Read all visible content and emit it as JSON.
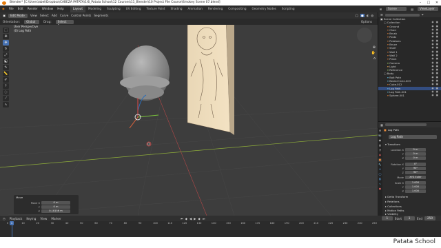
{
  "window": {
    "title": "Blender* [C:\\Users\\abel\\Dropbox\\CABEZA PATATA\\1\\6_Patata School\\12 Courses\\11_Blender\\10 Project File Course\\Smokey Scene 07.blend]",
    "controls": [
      "–",
      "□",
      "✕"
    ]
  },
  "menubar": {
    "menus": [
      "File",
      "Edit",
      "Render",
      "Window",
      "Help"
    ],
    "workspaces": [
      "Layout",
      "Modeling",
      "Sculpting",
      "UV Editing",
      "Texture Paint",
      "Shading",
      "Animation",
      "Rendering",
      "Compositing",
      "Geometry Nodes",
      "Scripting"
    ],
    "active_workspace": "Layout",
    "scene": "Scene",
    "view_layer": "ViewLayer"
  },
  "viewport": {
    "mode": "Edit Mode",
    "menus": [
      "View",
      "Select",
      "Add",
      "Curve",
      "Control Points",
      "Segments"
    ],
    "orientation_label": "Orientation:",
    "orientation_value": "Global",
    "drag_label": "Drag:",
    "drag_value": "Select Box",
    "options_label": "Options",
    "view_name": "User Perspective",
    "object_name": "(0) Log Path"
  },
  "last_operator": {
    "title": "Move",
    "rows": [
      {
        "label": "Move X",
        "value": "0 m"
      },
      {
        "label": "Y",
        "value": "0 m"
      },
      {
        "label": "Z",
        "value": "0.18156 m"
      }
    ],
    "axis_ortho_label": "Axis Ortho",
    "axis_ortho_value": "X",
    "orientation_label": "Orientation",
    "orientation_value": "Global",
    "proportional_label": "Proportional Editing"
  },
  "outliner": {
    "root": "Scene Collection",
    "items": [
      {
        "name": "Collection",
        "indent": 1,
        "color": "#d0d0d0"
      },
      {
        "name": "Ground",
        "indent": 2,
        "color": "#d07a3a"
      },
      {
        "name": "Chair",
        "indent": 2,
        "color": "#d07a3a"
      },
      {
        "name": "Brush",
        "indent": 2,
        "color": "#d07a3a"
      },
      {
        "name": "Posts",
        "indent": 2,
        "color": "#d07a3a"
      },
      {
        "name": "Potatoes",
        "indent": 2,
        "color": "#d07a3a"
      },
      {
        "name": "Bruce",
        "indent": 2,
        "color": "#d07a3a"
      },
      {
        "name": "Shelf",
        "indent": 2,
        "color": "#d07a3a"
      },
      {
        "name": "Wall 1",
        "indent": 2,
        "color": "#d07a3a"
      },
      {
        "name": "Wall 2",
        "indent": 2,
        "color": "#d07a3a"
      },
      {
        "name": "Plank",
        "indent": 2,
        "color": "#d07a3a"
      },
      {
        "name": "Camera",
        "indent": 2,
        "color": "#9acd60"
      },
      {
        "name": "Light",
        "indent": 2,
        "color": "#e0a050"
      },
      {
        "name": "Reference",
        "indent": 2,
        "color": "#9acd60"
      },
      {
        "name": "Body",
        "indent": 1,
        "color": "#d0d0d0"
      },
      {
        "name": "Bolt Path",
        "indent": 2,
        "color": "#5fb7d6"
      },
      {
        "name": "BezierCircle.003",
        "indent": 2,
        "color": "#5fb7d6"
      },
      {
        "name": "Cube.012",
        "indent": 2,
        "color": "#d07a3a"
      },
      {
        "name": "Log Path",
        "indent": 2,
        "color": "#5fb7d6",
        "selected": true
      },
      {
        "name": "Log Path.001",
        "indent": 2,
        "color": "#5fb7d6"
      },
      {
        "name": "Sphere.001",
        "indent": 2,
        "color": "#d07a3a"
      }
    ]
  },
  "properties": {
    "breadcrumb": "Log Path",
    "object_name": "Log Path",
    "transform_label": "Transform",
    "location_label": "Location X",
    "location": [
      "0 m",
      "0 m",
      "0 m"
    ],
    "rotation_label": "Rotation X",
    "rotation": [
      "0°",
      "90°",
      "90°"
    ],
    "mode_label": "Mode",
    "mode_value": "XYZ Euler",
    "scale_label": "Scale X",
    "scale": [
      "1.000",
      "1.000",
      "1.000"
    ],
    "axis_y": "Y",
    "axis_z": "Z",
    "sections": [
      "Delta Transform",
      "Relations",
      "Collections",
      "Motion Paths",
      "Visibility"
    ]
  },
  "timeline": {
    "menus": [
      "Playback",
      "Keying",
      "View",
      "Marker"
    ],
    "ticks": [
      "0",
      "10",
      "20",
      "30",
      "40",
      "50",
      "60",
      "70",
      "80",
      "90",
      "100",
      "110",
      "120",
      "130",
      "140",
      "150",
      "160",
      "170",
      "180",
      "190",
      "200",
      "210",
      "220",
      "230",
      "240",
      "250"
    ],
    "current_frame": "1",
    "start_label": "Start",
    "start": "1",
    "end_label": "End",
    "end": "250"
  },
  "brand": "Patata School",
  "colors": {
    "selection": "#334d80",
    "active_tool": "#4772b3",
    "playhead": "#4772b3"
  }
}
